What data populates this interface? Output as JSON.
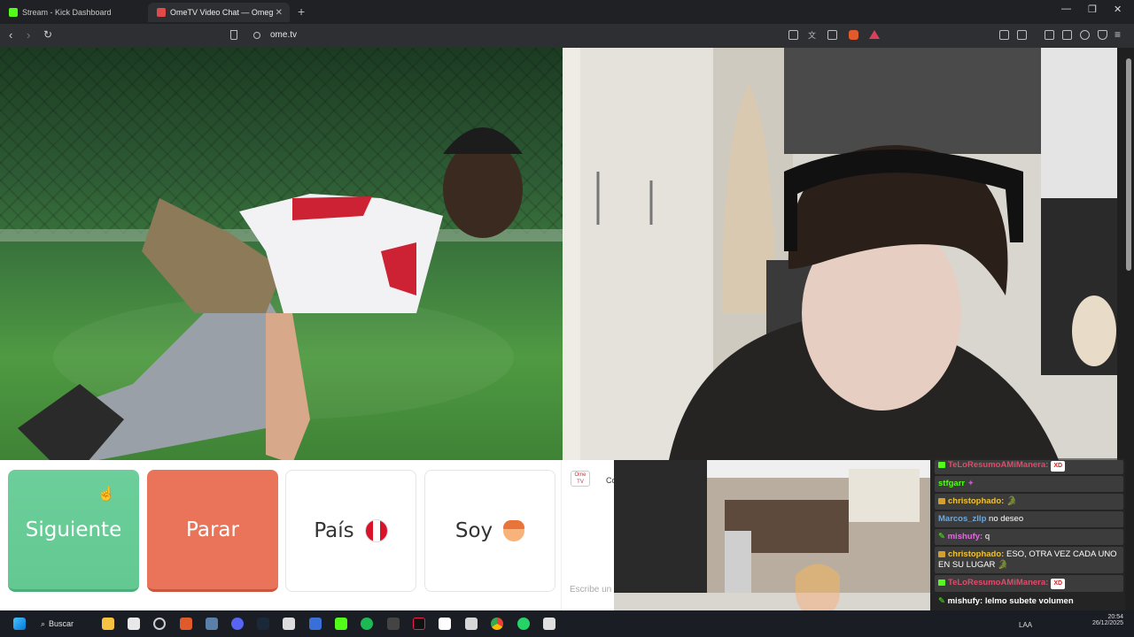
{
  "browser": {
    "tabs": [
      {
        "title": "Stream - Kick Dashboard",
        "favicon_color": "#53fc18"
      },
      {
        "title": "OmeTV Video Chat — Omeg",
        "favicon_color": "#e24a4a"
      }
    ],
    "new_tab_symbol": "+",
    "url": "ome.tv"
  },
  "controls": {
    "next_label": "Siguiente",
    "stop_label": "Parar",
    "country_label": "País",
    "gender_label": "Soy",
    "chat_placeholder": "Escribe un",
    "chat_partial": "Co",
    "logo_text": "Ome TV"
  },
  "stream_chat": {
    "messages": [
      {
        "user": "TeLoResumoAMiManera:",
        "text": "",
        "xd": true
      },
      {
        "user": "stfgarr",
        "text": ""
      },
      {
        "user": "christophado:",
        "text": ""
      },
      {
        "user": "Marcos_zllp",
        "text": "no deseo"
      },
      {
        "user": "mishufy:",
        "text": "q"
      },
      {
        "user": "christophado:",
        "text": "ESO, OTRA VEZ CADA UNO EN SU LUGAR"
      },
      {
        "user": "TeLoResumoAMiManera:",
        "text": "",
        "xd": true
      },
      {
        "user": "mishufy:",
        "text": "lelmo subete volumen"
      }
    ],
    "xd_badge": "XD"
  },
  "taskbar": {
    "search_label": "Buscar",
    "lang": "LAA",
    "time": "20:54",
    "date": "26/12/2025"
  }
}
